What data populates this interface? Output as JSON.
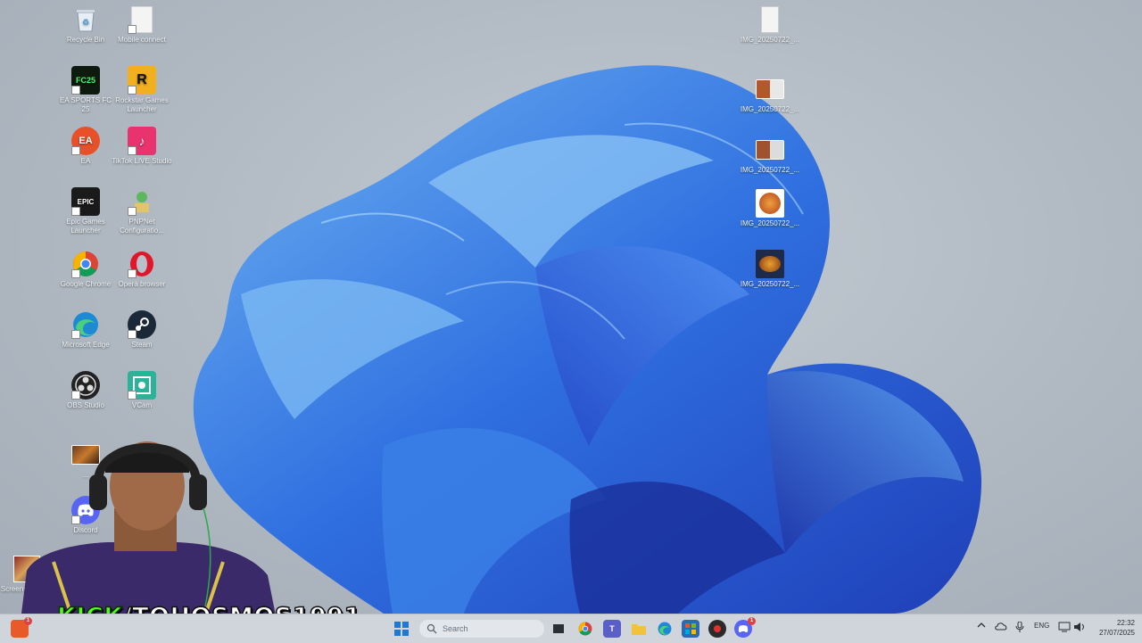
{
  "desktop_icons_left": [
    {
      "id": "recycle-bin",
      "label": "Recycle Bin",
      "col": 0,
      "row": 0
    },
    {
      "id": "mobile-connect",
      "label": "Mobile connect",
      "col": 1,
      "row": 0
    },
    {
      "id": "ea-sports-fc",
      "label": "EA SPORTS FC 25",
      "col": 0,
      "row": 1
    },
    {
      "id": "rockstar",
      "label": "Rockstar Games Launcher",
      "col": 1,
      "row": 1
    },
    {
      "id": "ea",
      "label": "EA",
      "col": 0,
      "row": 2
    },
    {
      "id": "tiktok-studio",
      "label": "TikTok LIVE Studio",
      "col": 1,
      "row": 2
    },
    {
      "id": "epic",
      "label": "Epic Games Launcher",
      "col": 0,
      "row": 3
    },
    {
      "id": "pnp",
      "label": "PNPNet Configuratio...",
      "col": 1,
      "row": 3
    },
    {
      "id": "chrome",
      "label": "Google Chrome",
      "col": 0,
      "row": 4
    },
    {
      "id": "opera",
      "label": "Opera browser",
      "col": 1,
      "row": 4
    },
    {
      "id": "edge",
      "label": "Microsoft Edge",
      "col": 0,
      "row": 5
    },
    {
      "id": "steam",
      "label": "Steam",
      "col": 1,
      "row": 5
    },
    {
      "id": "obs",
      "label": "OBS Studio",
      "col": 0,
      "row": 6
    },
    {
      "id": "vcam",
      "label": "VCam",
      "col": 1,
      "row": 6
    },
    {
      "id": "game-img",
      "label": "...",
      "col": 0,
      "row": 7
    },
    {
      "id": "discord",
      "label": "Discord",
      "col": 0,
      "row": 8
    }
  ],
  "screenshot_icon": {
    "label": "Screenshot 20..."
  },
  "desktop_icons_right": [
    {
      "id": "img1",
      "label": "IMG_20250722_..."
    },
    {
      "id": "img2",
      "label": "IMG_20250722_..."
    },
    {
      "id": "img3",
      "label": "IMG_20250722_..."
    },
    {
      "id": "img4",
      "label": "IMG_20250722_..."
    },
    {
      "id": "img5",
      "label": "IMG_20250722_..."
    }
  ],
  "overlay": {
    "kick": "KICK",
    "channel": "/TOHOSMOS1991"
  },
  "taskbar": {
    "search_placeholder": "Search",
    "language": "ENG",
    "time": "22:32",
    "date": "27/07/2025",
    "widget_badge": "1",
    "discord_badge": "1"
  },
  "colors": {
    "wallpaper_blue": "#2f6fe0",
    "kick_green": "#53fc18",
    "taskbar": "#cfd5db"
  }
}
